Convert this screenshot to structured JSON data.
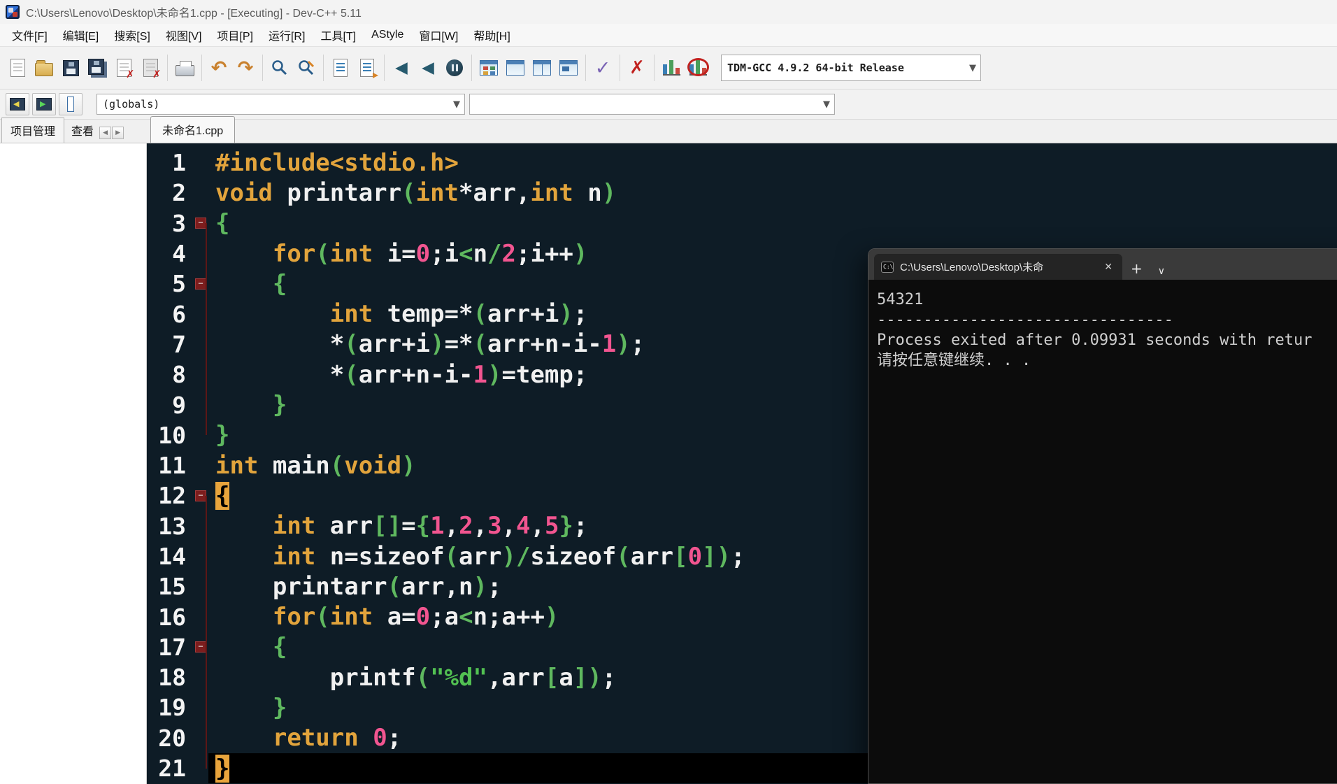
{
  "window": {
    "title": "C:\\Users\\Lenovo\\Desktop\\未命名1.cpp - [Executing] - Dev-C++ 5.11"
  },
  "menu": {
    "items": [
      "文件[F]",
      "编辑[E]",
      "搜索[S]",
      "视图[V]",
      "项目[P]",
      "运行[R]",
      "工具[T]",
      "AStyle",
      "窗口[W]",
      "帮助[H]"
    ]
  },
  "toolbar": {
    "compiler_combo": "TDM-GCC 4.9.2 64-bit Release",
    "globals_combo": "(globals)",
    "members_combo": ""
  },
  "panel_tabs": {
    "project": "项目管理",
    "view": "查看"
  },
  "editor": {
    "tab": "未命名1.cpp",
    "fold_ranges": [
      [
        3,
        10
      ],
      [
        12,
        21
      ]
    ],
    "lines": [
      {
        "n": 1,
        "fold": false,
        "cur": false,
        "segs": [
          [
            "k",
            "#include<stdio.h>"
          ]
        ]
      },
      {
        "n": 2,
        "fold": false,
        "cur": false,
        "segs": [
          [
            "k",
            "void"
          ],
          [
            "d",
            " printarr"
          ],
          [
            "g",
            "("
          ],
          [
            "k",
            "int"
          ],
          [
            "d",
            "*arr,"
          ],
          [
            "k",
            "int"
          ],
          [
            "d",
            " n"
          ],
          [
            "g",
            ")"
          ]
        ]
      },
      {
        "n": 3,
        "fold": true,
        "cur": false,
        "segs": [
          [
            "g",
            "{"
          ]
        ]
      },
      {
        "n": 4,
        "fold": false,
        "cur": false,
        "segs": [
          [
            "d",
            "    "
          ],
          [
            "k",
            "for"
          ],
          [
            "g",
            "("
          ],
          [
            "k",
            "int"
          ],
          [
            "d",
            " i="
          ],
          [
            "n",
            "0"
          ],
          [
            "d",
            ";i"
          ],
          [
            "g",
            "<"
          ],
          [
            "d",
            "n"
          ],
          [
            "g",
            "/"
          ],
          [
            "n",
            "2"
          ],
          [
            "d",
            ";i++"
          ],
          [
            "g",
            ")"
          ]
        ]
      },
      {
        "n": 5,
        "fold": true,
        "cur": false,
        "segs": [
          [
            "d",
            "    "
          ],
          [
            "g",
            "{"
          ]
        ]
      },
      {
        "n": 6,
        "fold": false,
        "cur": false,
        "segs": [
          [
            "d",
            "        "
          ],
          [
            "k",
            "int"
          ],
          [
            "d",
            " temp=*"
          ],
          [
            "g",
            "("
          ],
          [
            "d",
            "arr+i"
          ],
          [
            "g",
            ")"
          ],
          [
            "d",
            ";"
          ]
        ]
      },
      {
        "n": 7,
        "fold": false,
        "cur": false,
        "segs": [
          [
            "d",
            "        *"
          ],
          [
            "g",
            "("
          ],
          [
            "d",
            "arr+i"
          ],
          [
            "g",
            ")"
          ],
          [
            "d",
            "=*"
          ],
          [
            "g",
            "("
          ],
          [
            "d",
            "arr+n-i-"
          ],
          [
            "n",
            "1"
          ],
          [
            "g",
            ")"
          ],
          [
            "d",
            ";"
          ]
        ]
      },
      {
        "n": 8,
        "fold": false,
        "cur": false,
        "segs": [
          [
            "d",
            "        *"
          ],
          [
            "g",
            "("
          ],
          [
            "d",
            "arr+n-i-"
          ],
          [
            "n",
            "1"
          ],
          [
            "g",
            ")"
          ],
          [
            "d",
            "=temp;"
          ]
        ]
      },
      {
        "n": 9,
        "fold": false,
        "cur": false,
        "segs": [
          [
            "d",
            "    "
          ],
          [
            "g",
            "}"
          ]
        ]
      },
      {
        "n": 10,
        "fold": false,
        "cur": false,
        "segs": [
          [
            "g",
            "}"
          ]
        ]
      },
      {
        "n": 11,
        "fold": false,
        "cur": false,
        "segs": [
          [
            "k",
            "int"
          ],
          [
            "d",
            " main"
          ],
          [
            "g",
            "("
          ],
          [
            "k",
            "void"
          ],
          [
            "g",
            ")"
          ]
        ]
      },
      {
        "n": 12,
        "fold": true,
        "cur": false,
        "segs": [
          [
            "hl",
            "{"
          ]
        ]
      },
      {
        "n": 13,
        "fold": false,
        "cur": false,
        "segs": [
          [
            "d",
            "    "
          ],
          [
            "k",
            "int"
          ],
          [
            "d",
            " arr"
          ],
          [
            "g",
            "[]"
          ],
          [
            "d",
            "="
          ],
          [
            "g",
            "{"
          ],
          [
            "n",
            "1"
          ],
          [
            "d",
            ","
          ],
          [
            "n",
            "2"
          ],
          [
            "d",
            ","
          ],
          [
            "n",
            "3"
          ],
          [
            "d",
            ","
          ],
          [
            "n",
            "4"
          ],
          [
            "d",
            ","
          ],
          [
            "n",
            "5"
          ],
          [
            "g",
            "}"
          ],
          [
            "d",
            ";"
          ]
        ]
      },
      {
        "n": 14,
        "fold": false,
        "cur": false,
        "segs": [
          [
            "d",
            "    "
          ],
          [
            "k",
            "int"
          ],
          [
            "d",
            " n=sizeof"
          ],
          [
            "g",
            "("
          ],
          [
            "d",
            "arr"
          ],
          [
            "g",
            ")"
          ],
          [
            "g",
            "/"
          ],
          [
            "d",
            "sizeof"
          ],
          [
            "g",
            "("
          ],
          [
            "d",
            "arr"
          ],
          [
            "g",
            "["
          ],
          [
            "n",
            "0"
          ],
          [
            "g",
            "]"
          ],
          [
            "g",
            ")"
          ],
          [
            "d",
            ";"
          ]
        ]
      },
      {
        "n": 15,
        "fold": false,
        "cur": false,
        "segs": [
          [
            "d",
            "    printarr"
          ],
          [
            "g",
            "("
          ],
          [
            "d",
            "arr,n"
          ],
          [
            "g",
            ")"
          ],
          [
            "d",
            ";"
          ]
        ]
      },
      {
        "n": 16,
        "fold": false,
        "cur": false,
        "segs": [
          [
            "d",
            "    "
          ],
          [
            "k",
            "for"
          ],
          [
            "g",
            "("
          ],
          [
            "k",
            "int"
          ],
          [
            "d",
            " a="
          ],
          [
            "n",
            "0"
          ],
          [
            "d",
            ";a"
          ],
          [
            "g",
            "<"
          ],
          [
            "d",
            "n;a++"
          ],
          [
            "g",
            ")"
          ]
        ]
      },
      {
        "n": 17,
        "fold": true,
        "cur": false,
        "segs": [
          [
            "d",
            "    "
          ],
          [
            "g",
            "{"
          ]
        ]
      },
      {
        "n": 18,
        "fold": false,
        "cur": false,
        "segs": [
          [
            "d",
            "        printf"
          ],
          [
            "g",
            "("
          ],
          [
            "s",
            "\"%d\""
          ],
          [
            "d",
            ",arr"
          ],
          [
            "g",
            "["
          ],
          [
            "d",
            "a"
          ],
          [
            "g",
            "]"
          ],
          [
            "g",
            ")"
          ],
          [
            "d",
            ";"
          ]
        ]
      },
      {
        "n": 19,
        "fold": false,
        "cur": false,
        "segs": [
          [
            "d",
            "    "
          ],
          [
            "g",
            "}"
          ]
        ]
      },
      {
        "n": 20,
        "fold": false,
        "cur": false,
        "segs": [
          [
            "d",
            "    "
          ],
          [
            "k",
            "return"
          ],
          [
            "d",
            " "
          ],
          [
            "n",
            "0"
          ],
          [
            "d",
            ";"
          ]
        ]
      },
      {
        "n": 21,
        "fold": false,
        "cur": true,
        "segs": [
          [
            "hl",
            "}"
          ]
        ]
      }
    ]
  },
  "terminal": {
    "tab_title": "C:\\Users\\Lenovo\\Desktop\\未命",
    "lines": [
      "54321",
      "--------------------------------",
      "Process exited after 0.09931 seconds with retur",
      "请按任意键继续. . ."
    ]
  },
  "icons": {
    "undo": "↶",
    "redo": "↷",
    "nav_back": "◀",
    "nav_forward": "◀",
    "check": "✓",
    "cross": "✗",
    "tab_prev": "◀",
    "tab_next": "▶",
    "plus": "+",
    "chevron": "∨",
    "close": "✕",
    "minus": "−",
    "combo_arrow": "▼"
  },
  "colors": {
    "editor_bg": "#0e1c26",
    "keyword": "#e2a43c",
    "number": "#f25590",
    "string": "#52c152",
    "symbol": "#5fb85f",
    "current_line": "#000000",
    "brace_highlight": "#e8a43c",
    "terminal_bg": "#0c0c0c"
  }
}
